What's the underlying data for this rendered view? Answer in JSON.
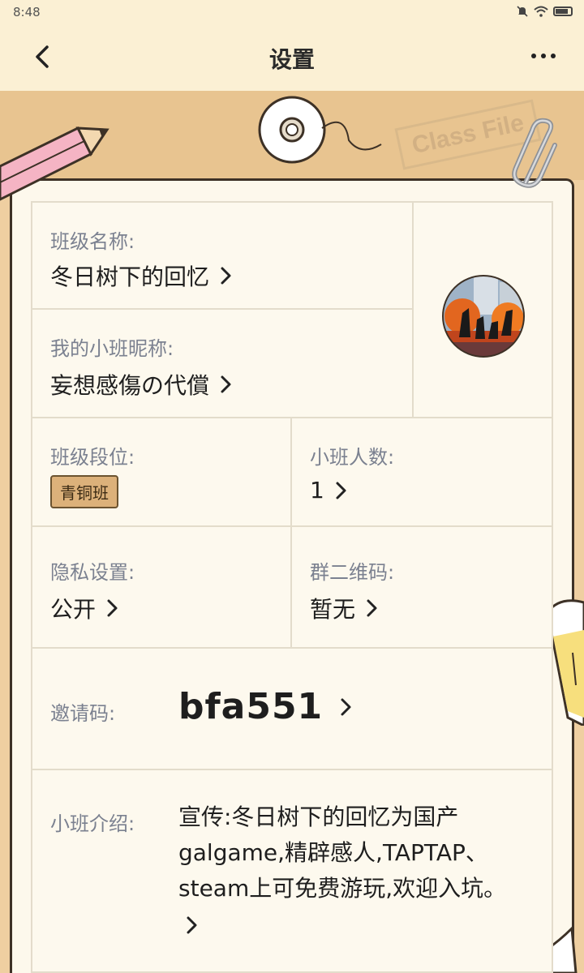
{
  "status": {
    "time": "8:48"
  },
  "nav": {
    "title": "设置"
  },
  "folder": {
    "stamp": "Class File"
  },
  "class_info": {
    "name_label": "班级名称:",
    "name_value": "冬日树下的回忆",
    "nickname_label": "我的小班昵称:",
    "nickname_value": "妄想感傷の代償",
    "rank_label": "班级段位:",
    "rank_badge": "青铜班",
    "members_label": "小班人数:",
    "members_value": "1",
    "privacy_label": "隐私设置:",
    "privacy_value": "公开",
    "qrcode_label": "群二维码:",
    "qrcode_value": "暂无",
    "invite_label": "邀请码:",
    "invite_value": "bfa551",
    "intro_label": "小班介绍:",
    "intro_value": "宣传:冬日树下的回忆为国产galgame,精辟感人,TAPTAP、steam上可免费游玩,欢迎入坑。"
  }
}
